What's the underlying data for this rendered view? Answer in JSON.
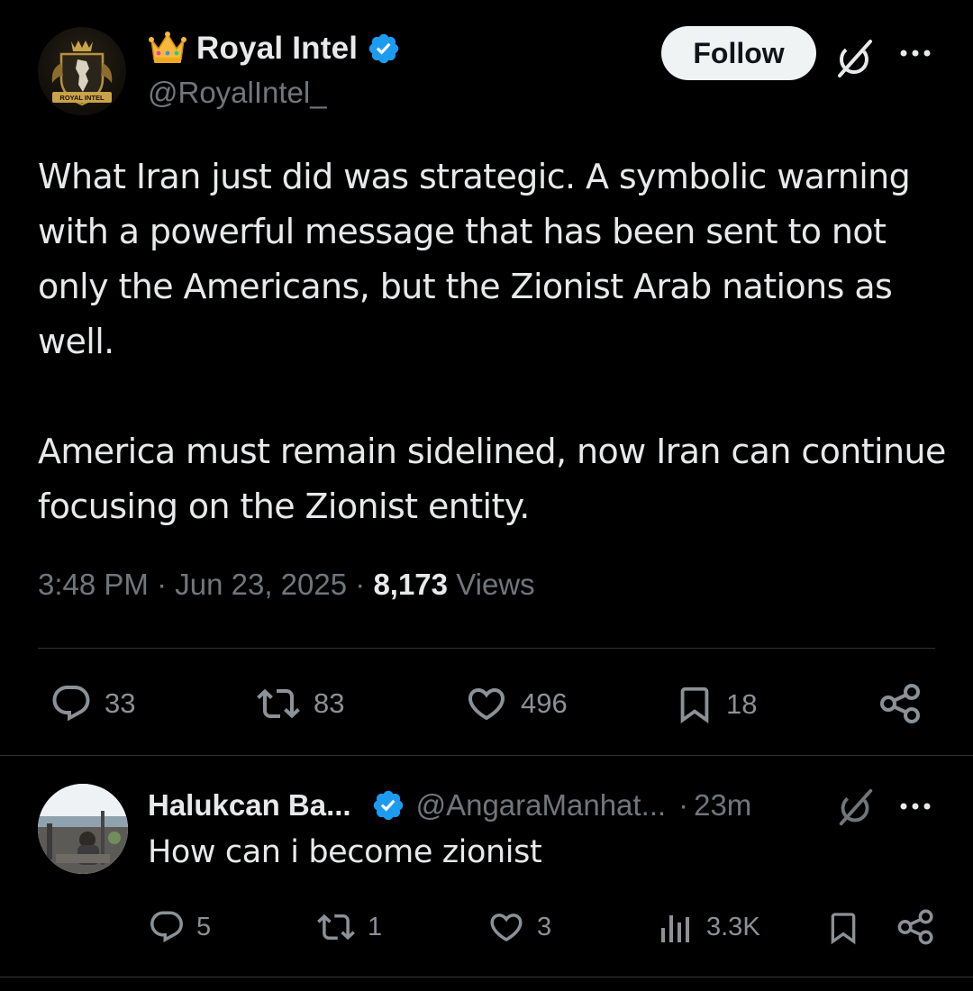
{
  "tweet": {
    "author_name": "Royal Intel",
    "author_handle": "@RoyalIntel_",
    "avatar_text": "ROYAL INTEL",
    "follow_label": "Follow",
    "paragraphs": [
      "What Iran just did was strategic. A symbolic warning with a powerful message that has been sent to not only the Americans, but the Zionist Arab nations as well.",
      "America must remain sidelined, now Iran can continue focusing on the Zionist entity."
    ],
    "time": "3:48 PM",
    "date": "Jun 23, 2025",
    "views_count": "8,173",
    "views_label": "Views",
    "meta_separator": "·",
    "stats": {
      "replies": "33",
      "reposts": "83",
      "likes": "496",
      "bookmarks": "18"
    }
  },
  "reply": {
    "author_name": "Halukcan Ba...",
    "author_handle": "@AngaraManhat...",
    "separator": "·",
    "time": "23m",
    "text": "How can i become zionist",
    "stats": {
      "replies": "5",
      "reposts": "1",
      "likes": "3",
      "views": "3.3K"
    }
  },
  "icons": {
    "verified": "verified-badge-icon",
    "grok": "grok-icon",
    "more": "more-options-icon",
    "reply": "reply-bubble-icon",
    "repost": "repost-icon",
    "like": "heart-icon",
    "bookmark": "bookmark-icon",
    "share": "share-icon",
    "views": "views-chart-icon"
  },
  "colors": {
    "background": "#000000",
    "text_primary": "#e7e9ea",
    "text_secondary": "#71767b",
    "verified_blue": "#1d9bf0",
    "divider": "#2f3336",
    "follow_bg": "#eff3f4"
  }
}
